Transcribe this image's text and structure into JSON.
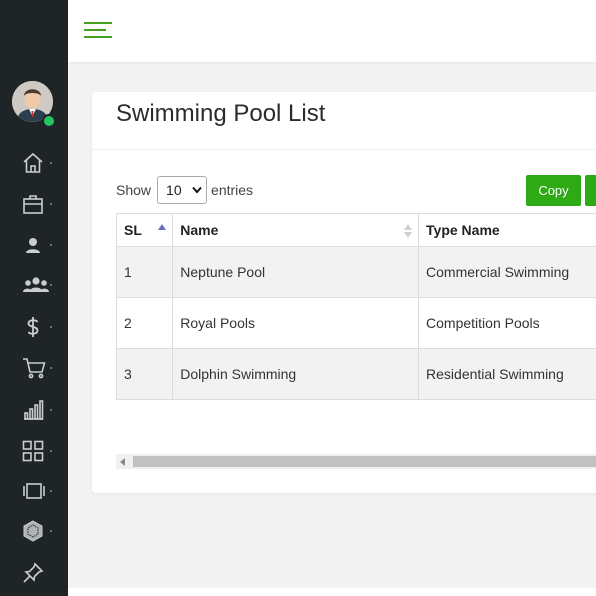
{
  "page": {
    "title": "Swimming Pool List"
  },
  "table_controls": {
    "show_label": "Show",
    "page_length": "10",
    "entries_label": "entries",
    "copy_label": "Copy"
  },
  "table": {
    "headers": [
      "SL",
      "Name",
      "Type Name"
    ],
    "rows": [
      [
        "1",
        "Neptune Pool",
        "Commercial Swimming"
      ],
      [
        "2",
        "Royal Pools",
        "Competition Pools"
      ],
      [
        "3",
        "Dolphin Swimming",
        "Residential Swimming"
      ]
    ]
  },
  "sidebar": {
    "items": [
      {
        "icon": "home-icon"
      },
      {
        "icon": "briefcase-icon"
      },
      {
        "icon": "user-icon"
      },
      {
        "icon": "users-icon"
      },
      {
        "icon": "dollar-icon"
      },
      {
        "icon": "cart-icon"
      },
      {
        "icon": "bar-chart-icon"
      },
      {
        "icon": "grid-icon"
      },
      {
        "icon": "slides-icon"
      },
      {
        "icon": "hexagon-icon"
      },
      {
        "icon": "pin-icon"
      }
    ]
  },
  "colors": {
    "sidebar_bg": "#1f2426",
    "accent": "#2eaa14",
    "online": "#22c55e"
  }
}
